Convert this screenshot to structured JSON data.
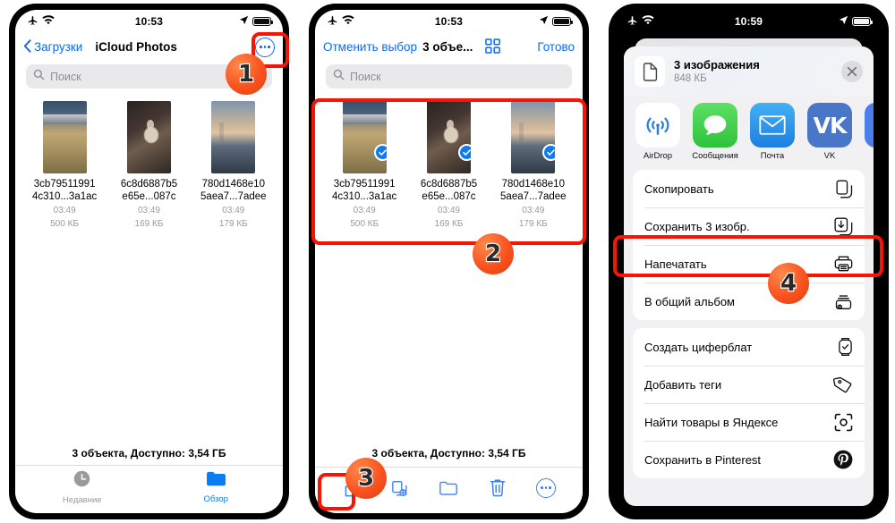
{
  "panels": [
    {
      "id": "files-browse",
      "status": {
        "time": "10:53",
        "airplane": "airplane-icon",
        "wifi": "wifi-icon",
        "location": "location-arrow-icon",
        "battery": "battery-icon"
      },
      "nav": {
        "back_label": "Загрузки",
        "title": "iCloud Photos",
        "more_button": "more-circle-icon"
      },
      "search": {
        "placeholder": "Поиск",
        "icon": "search-icon"
      },
      "files": [
        {
          "name_line1": "3cb79511991",
          "name_line2": "4c310...3a1ac",
          "time": "03:49",
          "size": "500 КБ",
          "selected": false
        },
        {
          "name_line1": "6c8d6887b5",
          "name_line2": "e65e...087c",
          "time": "03:49",
          "size": "169 КБ",
          "selected": false
        },
        {
          "name_line1": "780d1468e10",
          "name_line2": "5aea7...7adee",
          "time": "03:49",
          "size": "179 КБ",
          "selected": false
        }
      ],
      "status_line": "3 объекта, Доступно: 3,54 ГБ",
      "tabs": [
        {
          "label": "Недавние",
          "icon": "clock-icon",
          "active": false
        },
        {
          "label": "Обзор",
          "icon": "folder-icon",
          "active": true
        }
      ]
    },
    {
      "id": "files-selection",
      "status": {
        "time": "10:53"
      },
      "nav": {
        "cancel_label": "Отменить выбор",
        "title": "3 объе...",
        "grid_button": "grid-view-icon",
        "done_label": "Готово"
      },
      "search": {
        "placeholder": "Поиск",
        "icon": "search-icon"
      },
      "files": [
        {
          "name_line1": "3cb79511991",
          "name_line2": "4c310...3a1ac",
          "time": "03:49",
          "size": "500 КБ",
          "selected": true
        },
        {
          "name_line1": "6c8d6887b5",
          "name_line2": "e65e...087c",
          "time": "03:49",
          "size": "169 КБ",
          "selected": true
        },
        {
          "name_line1": "780d1468e10",
          "name_line2": "5aea7...7adee",
          "time": "03:49",
          "size": "179 КБ",
          "selected": true
        }
      ],
      "status_line": "3 объекта, Доступно: 3,54 ГБ",
      "toolbar": [
        {
          "icon": "share-icon"
        },
        {
          "icon": "duplicate-icon"
        },
        {
          "icon": "folder-move-icon"
        },
        {
          "icon": "trash-icon"
        },
        {
          "icon": "more-circle-icon"
        }
      ]
    },
    {
      "id": "share-sheet",
      "status": {
        "time": "10:59"
      },
      "sheet_header": {
        "title": "3 изображения",
        "subtitle": "848 КБ",
        "doc_icon": "document-icon",
        "close_icon": "close-icon"
      },
      "apps": [
        {
          "label": "AirDrop",
          "icon": "airdrop-icon"
        },
        {
          "label": "Сообщения",
          "icon": "messages-icon"
        },
        {
          "label": "Почта",
          "icon": "mail-icon"
        },
        {
          "label": "VK",
          "icon": "vk-icon"
        },
        {
          "label": "",
          "icon": "partial-app-icon"
        }
      ],
      "actions_group1": [
        {
          "label": "Скопировать",
          "icon": "copy-icon"
        },
        {
          "label": "Сохранить 3 изобр.",
          "icon": "save-to-photos-icon"
        },
        {
          "label": "Напечатать",
          "icon": "printer-icon"
        },
        {
          "label": "В общий альбом",
          "icon": "shared-album-icon"
        }
      ],
      "actions_group2": [
        {
          "label": "Создать циферблат",
          "icon": "watch-face-icon"
        },
        {
          "label": "Добавить теги",
          "icon": "tag-icon"
        },
        {
          "label": "Найти товары в Яндексе",
          "icon": "yandex-lens-icon"
        },
        {
          "label": "Сохранить в Pinterest",
          "icon": "pinterest-icon"
        }
      ]
    }
  ],
  "annotations": {
    "badges": [
      {
        "number": "1"
      },
      {
        "number": "2"
      },
      {
        "number": "3"
      },
      {
        "number": "4"
      }
    ],
    "highlight_color": "#f71404",
    "badge_color": "#f9521f"
  }
}
